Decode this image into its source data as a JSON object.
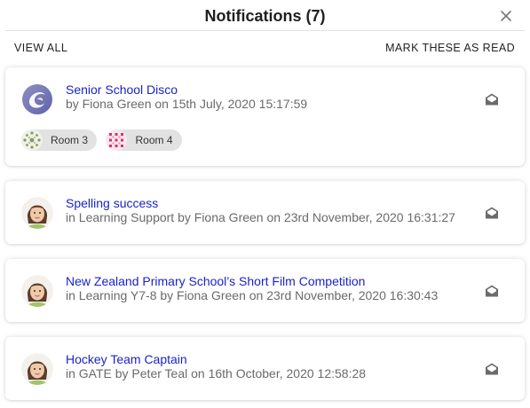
{
  "header": {
    "title": "Notifications (7)",
    "close_icon": "close-icon"
  },
  "actions": {
    "view_all": "VIEW ALL",
    "mark_read": "MARK THESE AS READ"
  },
  "colors": {
    "link": "#1a23c9",
    "meta": "#6a6a6a",
    "chip_bg": "#e2e2e2"
  },
  "notifications": [
    {
      "title": "Senior School Disco",
      "meta": "by Fiona Green on 15th July, 2020 15:17:59",
      "avatar_icon": "school-logo-swirl-icon",
      "mail_icon": "envelope-open-icon",
      "chips": [
        {
          "label": "Room 3",
          "icon": "room-3-pattern-icon"
        },
        {
          "label": "Room 4",
          "icon": "room-4-pattern-icon"
        }
      ]
    },
    {
      "title": "Spelling success",
      "meta": "in Learning Support by Fiona Green on 23rd November, 2020 16:31:27",
      "avatar_icon": "user-photo-avatar",
      "mail_icon": "envelope-open-icon"
    },
    {
      "title": "New Zealand Primary School’s Short Film Competition",
      "meta": "in Learning Y7-8 by Fiona Green on 23rd November, 2020 16:30:43",
      "avatar_icon": "user-photo-avatar",
      "mail_icon": "envelope-open-icon"
    },
    {
      "title": "Hockey Team Captain",
      "meta": "in GATE by Peter Teal on 16th October, 2020 12:58:28",
      "avatar_icon": "user-photo-avatar",
      "mail_icon": "envelope-open-icon"
    }
  ]
}
